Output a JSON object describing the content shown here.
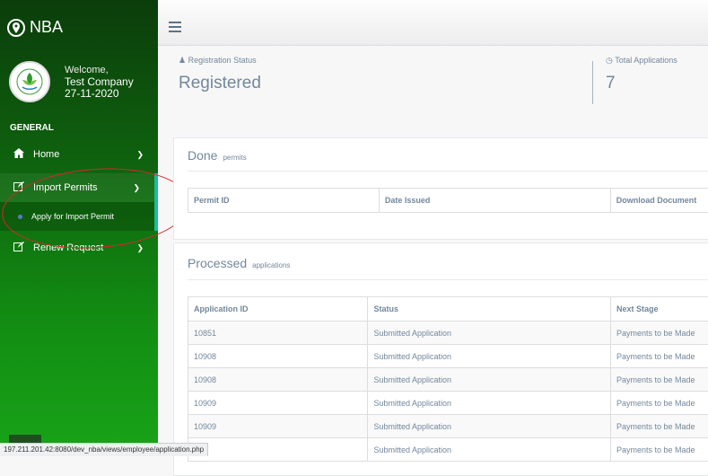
{
  "brand": {
    "name": "NBA",
    "icon": "map-marker-icon"
  },
  "profile": {
    "welcome": "Welcome,",
    "company": "Test Company 27-11-2020"
  },
  "sidebar": {
    "section": "GENERAL",
    "items": [
      {
        "label": "Home",
        "icon": "home-icon"
      },
      {
        "label": "Import Permits",
        "icon": "edit-icon"
      },
      {
        "label": "Renew Request",
        "icon": "edit-icon"
      }
    ],
    "submenu": {
      "label": "Apply for Import Permit"
    }
  },
  "stats": {
    "registration": {
      "label": "Registration Status",
      "value": "Registered",
      "icon": "user-icon"
    },
    "applications": {
      "label": "Total Applications",
      "value": "7",
      "icon": "clock-icon"
    }
  },
  "done": {
    "title": "Done",
    "subtitle": "permits",
    "columns": [
      "Permit ID",
      "Date Issued",
      "Download Document"
    ]
  },
  "processed": {
    "title": "Processed",
    "subtitle": "applications",
    "columns": [
      "Application ID",
      "Status",
      "Next Stage"
    ],
    "rows": [
      {
        "id": "10851",
        "status": "Submitted Application",
        "next": "Payments to be Made"
      },
      {
        "id": "10908",
        "status": "Submitted Application",
        "next": "Payments to be Made"
      },
      {
        "id": "10908",
        "status": "Submitted Application",
        "next": "Payments to be Made"
      },
      {
        "id": "10909",
        "status": "Submitted Application",
        "next": "Payments to be Made"
      },
      {
        "id": "10909",
        "status": "Submitted Application",
        "next": "Payments to be Made"
      },
      {
        "id": "",
        "status": "Submitted Application",
        "next": "Payments to be Made"
      }
    ]
  },
  "status_url": "197.211.201.42:8080/dev_nba/views/employee/application.php"
}
